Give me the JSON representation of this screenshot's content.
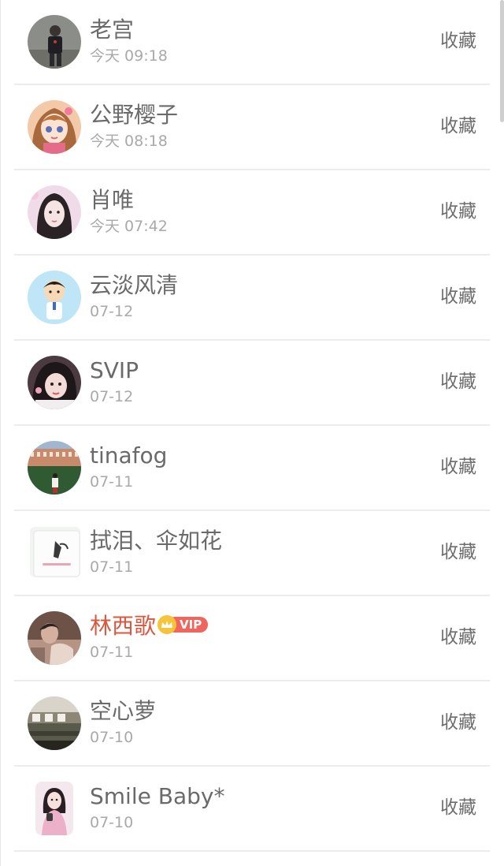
{
  "action_label": "收藏",
  "items": [
    {
      "name": "老宫",
      "time": "今天 09:18",
      "avatar_icon": "avatar-person-dark"
    },
    {
      "name": "公野樱子",
      "time": "今天 08:18",
      "avatar_icon": "avatar-anime-girl"
    },
    {
      "name": "肖唯",
      "time": "今天 07:42",
      "avatar_icon": "avatar-woman-portrait"
    },
    {
      "name": "云淡风清",
      "time": "07-12",
      "avatar_icon": "avatar-cartoon-boy"
    },
    {
      "name": "SVIP",
      "time": "07-12",
      "avatar_icon": "avatar-girl-selfie"
    },
    {
      "name": "tinafog",
      "time": "07-11",
      "avatar_icon": "avatar-building-lawn"
    },
    {
      "name": "拭泪、伞如花",
      "time": "07-11",
      "avatar_icon": "avatar-sketch-card"
    },
    {
      "name": "林西歌",
      "time": "07-11",
      "avatar_icon": "avatar-person-sepia",
      "vip": true,
      "vip_label": "VIP"
    },
    {
      "name": "空心萝",
      "time": "07-10",
      "avatar_icon": "avatar-landscape"
    },
    {
      "name": "Smile Baby*",
      "time": "07-10",
      "avatar_icon": "avatar-girl-pink"
    }
  ],
  "colors": {
    "name": "#6a6a6a",
    "vip_name": "#d9583f",
    "time": "#a9a9a9",
    "divider": "#ececec",
    "vip_badge": "#f0665f",
    "crown": "#f6c43b"
  }
}
